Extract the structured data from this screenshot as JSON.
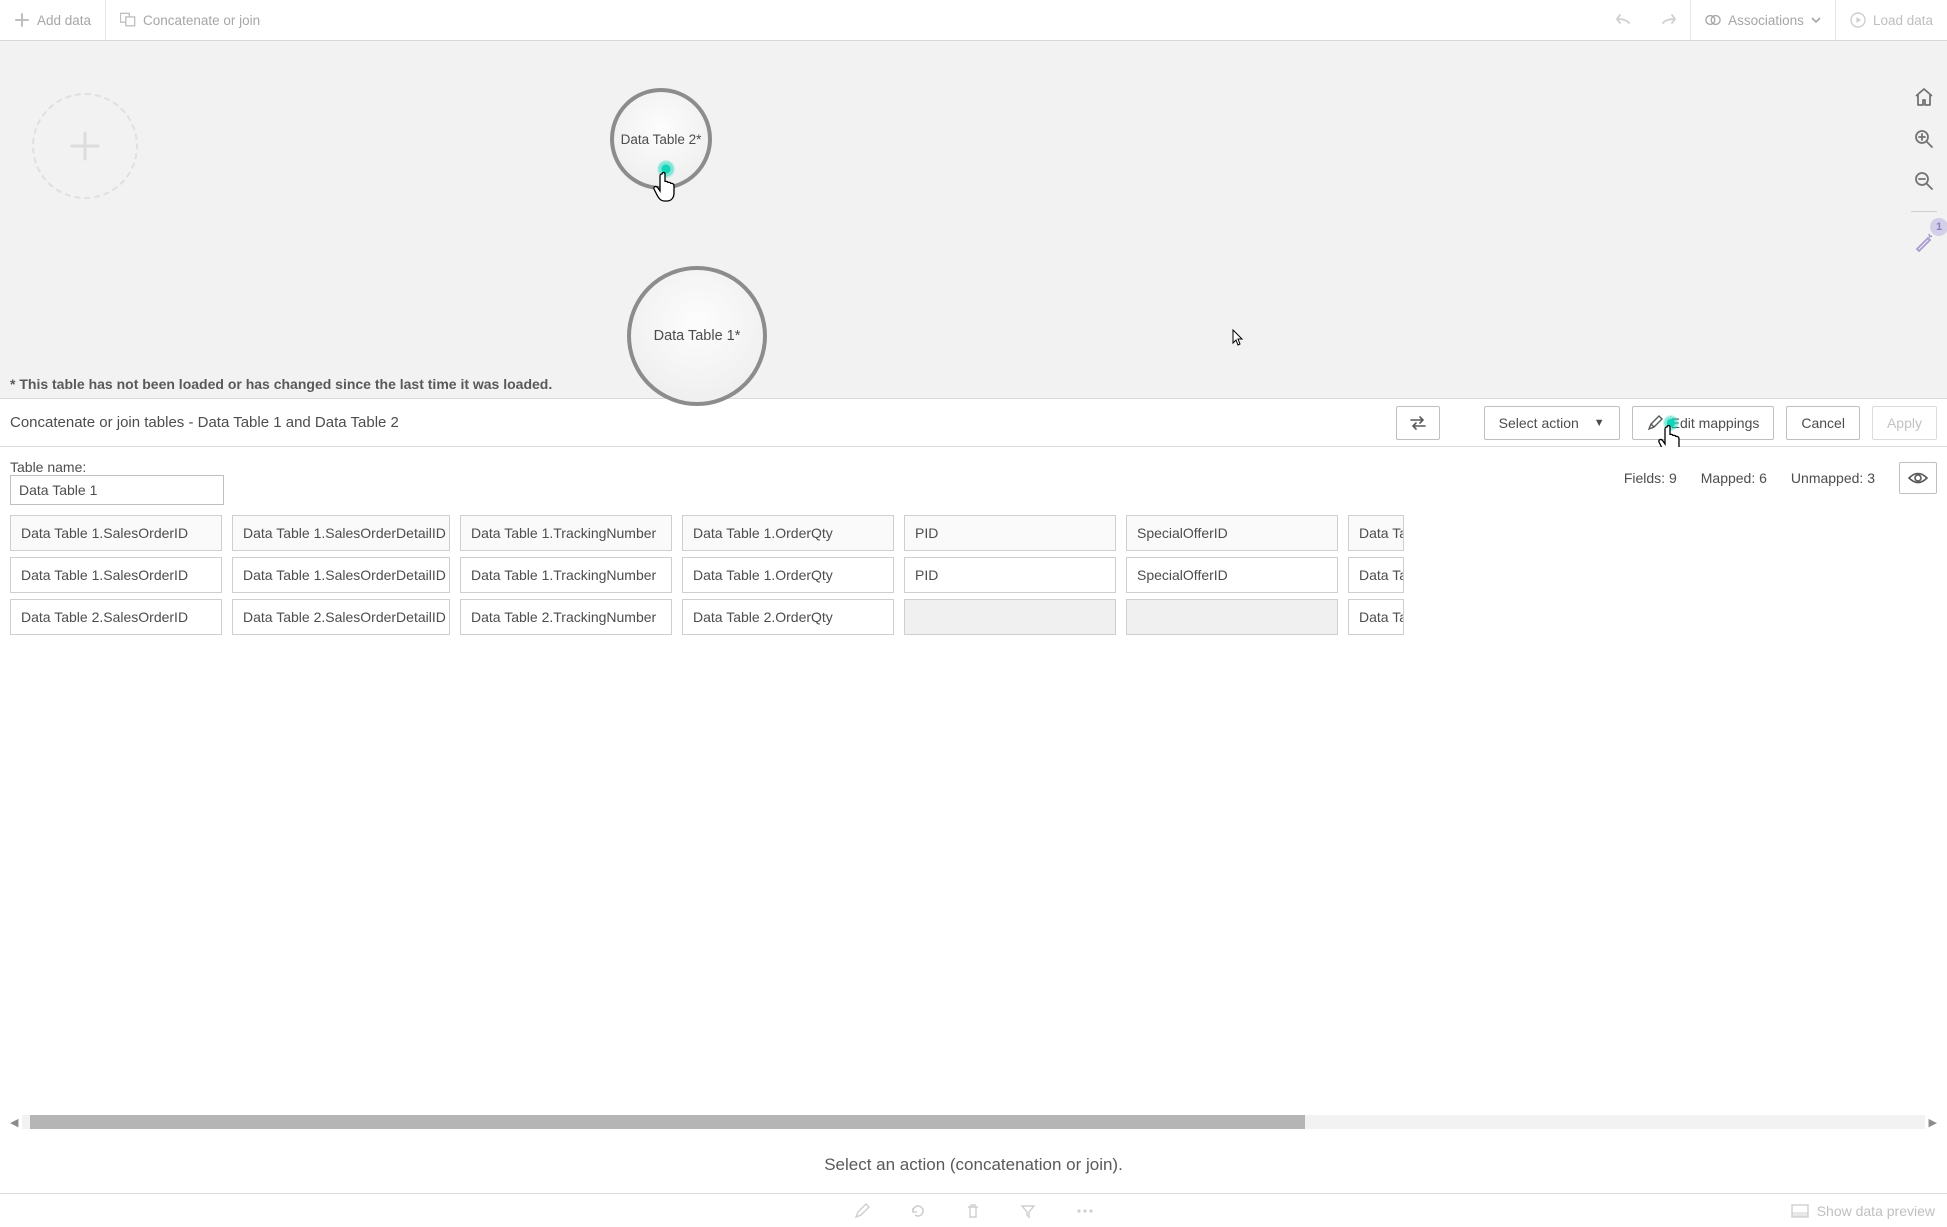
{
  "toolbar": {
    "add_data": "Add data",
    "concat_join": "Concatenate or join",
    "associations": "Associations",
    "load_data": "Load data"
  },
  "canvas": {
    "bubble2": "Data Table 2*",
    "bubble1": "Data Table 1*",
    "note": "* This table has not been loaded or has changed since the last time it was loaded.",
    "badge": "1"
  },
  "panel": {
    "title": "Concatenate or join tables - Data Table 1 and Data Table 2",
    "select_action": "Select action",
    "edit_mappings": "Edit mappings",
    "cancel": "Cancel",
    "apply": "Apply"
  },
  "mapping": {
    "table_name_label": "Table name:",
    "table_name_value": "Data Table 1",
    "fields_label": "Fields:",
    "fields_value": "9",
    "mapped_label": "Mapped:",
    "mapped_value": "6",
    "unmapped_label": "Unmapped:",
    "unmapped_value": "3",
    "columns": [
      {
        "header": "Data Table 1.SalesOrderID",
        "r1": "Data Table 1.SalesOrderID",
        "r2": "Data Table 2.SalesOrderID"
      },
      {
        "header": "Data Table 1.SalesOrderDetailID",
        "r1": "Data Table 1.SalesOrderDetailID",
        "r2": "Data Table 2.SalesOrderDetailID"
      },
      {
        "header": "Data Table 1.TrackingNumber",
        "r1": "Data Table 1.TrackingNumber",
        "r2": "Data Table 2.TrackingNumber"
      },
      {
        "header": "Data Table 1.OrderQty",
        "r1": "Data Table 1.OrderQty",
        "r2": "Data Table 2.OrderQty"
      },
      {
        "header": "PID",
        "r1": "PID",
        "r2": ""
      },
      {
        "header": "SpecialOfferID",
        "r1": "SpecialOfferID",
        "r2": ""
      },
      {
        "header": "Data Ta",
        "r1": "Data Ta",
        "r2": "Data Ta"
      }
    ],
    "hint": "Select an action (concatenation or join)."
  },
  "bottom": {
    "show_preview": "Show data preview"
  }
}
